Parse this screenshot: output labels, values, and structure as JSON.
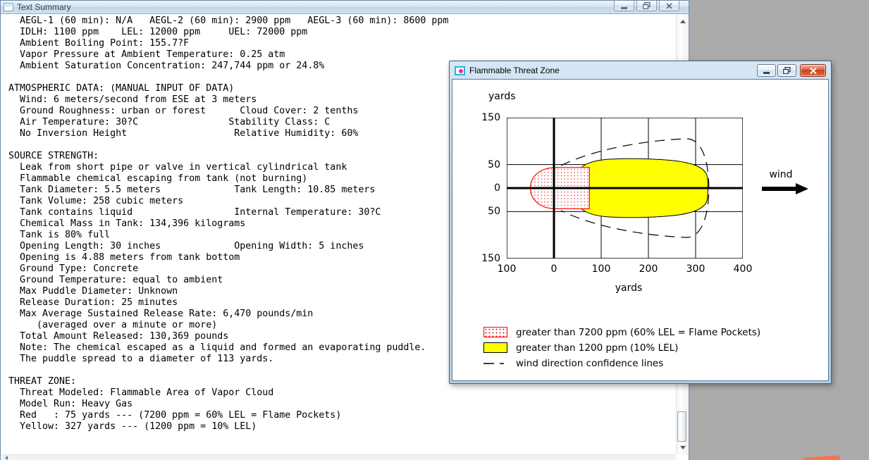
{
  "app_background_color": "#ababab",
  "text_summary_window": {
    "title": "Text Summary",
    "window_controls": {
      "minimize": "minimize",
      "restore": "restore-down",
      "close": "close"
    },
    "report_lines": [
      "  AEGL-1 (60 min): N/A   AEGL-2 (60 min): 2900 ppm   AEGL-3 (60 min): 8600 ppm",
      "  IDLH: 1100 ppm    LEL: 12000 ppm     UEL: 72000 ppm",
      "  Ambient Boiling Point: 155.7?F",
      "  Vapor Pressure at Ambient Temperature: 0.25 atm",
      "  Ambient Saturation Concentration: 247,744 ppm or 24.8%",
      "",
      "ATMOSPHERIC DATA: (MANUAL INPUT OF DATA)",
      "  Wind: 6 meters/second from ESE at 3 meters",
      "  Ground Roughness: urban or forest      Cloud Cover: 2 tenths",
      "  Air Temperature: 30?C                Stability Class: C",
      "  No Inversion Height                   Relative Humidity: 60%",
      "",
      "SOURCE STRENGTH:",
      "  Leak from short pipe or valve in vertical cylindrical tank",
      "  Flammable chemical escaping from tank (not burning)",
      "  Tank Diameter: 5.5 meters             Tank Length: 10.85 meters",
      "  Tank Volume: 258 cubic meters",
      "  Tank contains liquid                  Internal Temperature: 30?C",
      "  Chemical Mass in Tank: 134,396 kilograms",
      "  Tank is 80% full",
      "  Opening Length: 30 inches             Opening Width: 5 inches",
      "  Opening is 4.88 meters from tank bottom",
      "  Ground Type: Concrete",
      "  Ground Temperature: equal to ambient",
      "  Max Puddle Diameter: Unknown",
      "  Release Duration: 25 minutes",
      "  Max Average Sustained Release Rate: 6,470 pounds/min",
      "     (averaged over a minute or more)",
      "  Total Amount Released: 130,369 pounds",
      "  Note: The chemical escaped as a liquid and formed an evaporating puddle.",
      "  The puddle spread to a diameter of 113 yards.",
      "",
      "THREAT ZONE:",
      "  Threat Modeled: Flammable Area of Vapor Cloud",
      "  Model Run: Heavy Gas",
      "  Red   : 75 yards --- (7200 ppm = 60% LEL = Flame Pockets)",
      "  Yellow: 327 yards --- (1200 ppm = 10% LEL)"
    ]
  },
  "threat_zone_window": {
    "title": "Flammable Threat Zone",
    "window_controls": {
      "minimize": "minimize",
      "restore": "restore-down",
      "close": "close"
    },
    "wind_label": "wind",
    "legend": [
      {
        "swatch": "red-dotted",
        "label": "greater than 7200 ppm (60% LEL = Flame Pockets)",
        "color": "#ff0000"
      },
      {
        "swatch": "yellow-fill",
        "label": "greater than 1200 ppm (10% LEL)",
        "color": "#ffff00"
      },
      {
        "swatch": "dashed-line",
        "label": "wind direction confidence lines",
        "color": "#000000"
      }
    ]
  },
  "chart_data": {
    "type": "area",
    "title": "Flammable Threat Zone",
    "xlabel": "yards",
    "ylabel": "yards",
    "xlim": [
      -100,
      400
    ],
    "ylim": [
      -150,
      150
    ],
    "x_tick_labels": [
      "100",
      "0",
      "100",
      "200",
      "300",
      "400"
    ],
    "y_tick_labels": [
      "150",
      "50",
      "0",
      "50",
      "150"
    ],
    "grid": true,
    "legend_position": "bottom-left",
    "series": [
      {
        "name": "greater than 7200 ppm (60% LEL = Flame Pockets)",
        "zone": "red",
        "fill": "red dot hatch on white",
        "outline": "#ff0000",
        "downwind_extent_yards": 75,
        "upwind_extent_yards": -50,
        "max_half_width_yards": 44
      },
      {
        "name": "greater than 1200 ppm (10% LEL)",
        "zone": "yellow",
        "fill": "#ffff00",
        "outline": "#000000",
        "downwind_extent_yards": 327,
        "left_edge_yards": 48,
        "max_half_width_yards": 63
      },
      {
        "name": "wind direction confidence lines",
        "zone": "confidence",
        "style": "dashed black",
        "downwind_extent_yards": 330,
        "max_half_width_yards": 106
      }
    ],
    "annotations": [
      {
        "text": "wind",
        "type": "arrow",
        "direction": "right"
      }
    ]
  }
}
